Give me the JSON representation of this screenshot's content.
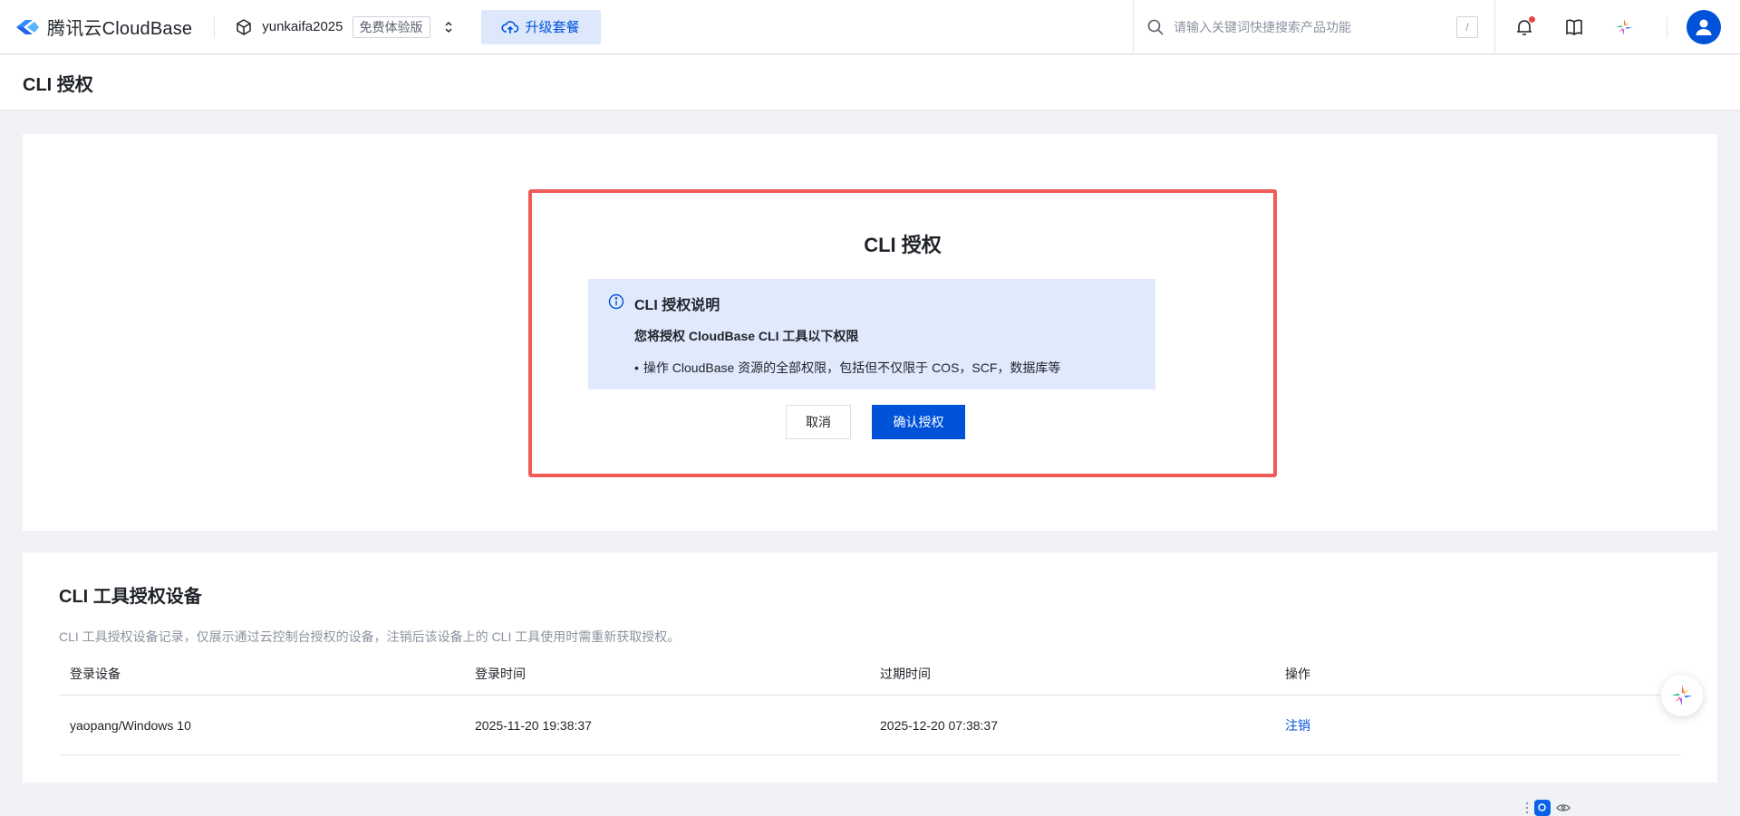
{
  "brand": {
    "name": "腾讯云CloudBase"
  },
  "env": {
    "name": "yunkaifa2025",
    "badge": "免费体验版"
  },
  "header": {
    "upgrade_label": "升级套餐"
  },
  "search": {
    "placeholder": "请输入关键词快捷搜索产品功能",
    "shortcut": "/"
  },
  "notifications": {
    "has_unread": true
  },
  "page": {
    "title": "CLI 授权"
  },
  "auth": {
    "title": "CLI 授权",
    "info_title": "CLI 授权说明",
    "info_subtitle": "您将授权 CloudBase CLI 工具以下权限",
    "bullet": "操作 CloudBase 资源的全部权限，包括但不仅限于 COS，SCF，数据库等",
    "cancel_label": "取消",
    "confirm_label": "确认授权"
  },
  "devices": {
    "title": "CLI 工具授权设备",
    "description": "CLI 工具授权设备记录，仅展示通过云控制台授权的设备，注销后该设备上的 CLI 工具使用时需重新获取授权。",
    "columns": [
      "登录设备",
      "登录时间",
      "过期时间",
      "操作"
    ],
    "rows": [
      {
        "device": "yaopang/Windows 10",
        "login_time": "2025-11-20 19:38:37",
        "expire_time": "2025-12-20 07:38:37",
        "action": "注销"
      }
    ]
  },
  "colors": {
    "primary": "#0052d9",
    "highlight_border": "#f05a57",
    "info_bg": "#e1eafd",
    "page_bg": "#f1f2f5"
  }
}
